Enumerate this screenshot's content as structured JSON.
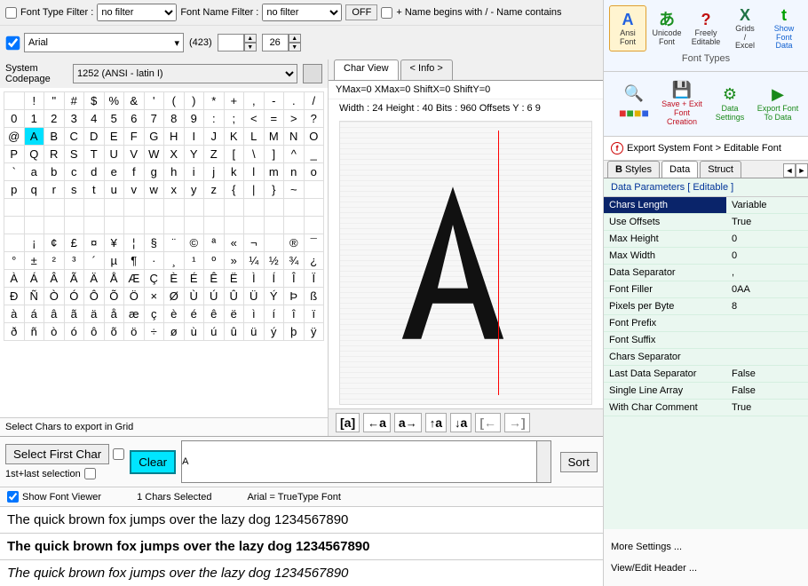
{
  "filters": {
    "fontTypeLabel": "Font Type Filter :",
    "fontTypeValue": "no filter",
    "fontNameLabel": "Font Name Filter :",
    "fontNameValue": "no filter",
    "offLabel": "OFF",
    "nameBeginsLabel": "+ Name begins with / - Name contains"
  },
  "fontRow": {
    "fontName": "Arial",
    "count": "(423)",
    "size": "26"
  },
  "codepage": {
    "label": "System Codepage",
    "value": "1252  (ANSI - latin I)"
  },
  "charGrid": {
    "rows": [
      [
        "",
        "!",
        "\"",
        "#",
        "$",
        "%",
        "&",
        "'",
        "(",
        ")",
        "*",
        "+",
        ",",
        "-",
        ".",
        "/"
      ],
      [
        "0",
        "1",
        "2",
        "3",
        "4",
        "5",
        "6",
        "7",
        "8",
        "9",
        ":",
        ";",
        "<",
        "=",
        ">",
        "?"
      ],
      [
        "@",
        "A",
        "B",
        "C",
        "D",
        "E",
        "F",
        "G",
        "H",
        "I",
        "J",
        "K",
        "L",
        "M",
        "N",
        "O"
      ],
      [
        "P",
        "Q",
        "R",
        "S",
        "T",
        "U",
        "V",
        "W",
        "X",
        "Y",
        "Z",
        "[",
        "\\",
        "]",
        "^",
        "_"
      ],
      [
        "`",
        "a",
        "b",
        "c",
        "d",
        "e",
        "f",
        "g",
        "h",
        "i",
        "j",
        "k",
        "l",
        "m",
        "n",
        "o"
      ],
      [
        "p",
        "q",
        "r",
        "s",
        "t",
        "u",
        "v",
        "w",
        "x",
        "y",
        "z",
        "{",
        "|",
        "}",
        "~",
        ""
      ],
      [
        "",
        "",
        "",
        "",
        "",
        "",
        "",
        "",
        "",
        "",
        "",
        "",
        "",
        "",
        "",
        ""
      ],
      [
        "",
        "",
        "",
        "",
        "",
        "",
        "",
        "",
        "",
        "",
        "",
        "",
        "",
        "",
        "",
        ""
      ],
      [
        "",
        "¡",
        "¢",
        "£",
        "¤",
        "¥",
        "¦",
        "§",
        "¨",
        "©",
        "ª",
        "«",
        "¬",
        "",
        "®",
        "¯"
      ],
      [
        "°",
        "±",
        "²",
        "³",
        "´",
        "µ",
        "¶",
        "·",
        "¸",
        "¹",
        "º",
        "»",
        "¼",
        "½",
        "¾",
        "¿"
      ],
      [
        "À",
        "Á",
        "Â",
        "Ã",
        "Ä",
        "Å",
        "Æ",
        "Ç",
        "È",
        "É",
        "Ê",
        "Ë",
        "Ì",
        "Í",
        "Î",
        "Ï"
      ],
      [
        "Ð",
        "Ñ",
        "Ò",
        "Ó",
        "Ô",
        "Õ",
        "Ö",
        "×",
        "Ø",
        "Ù",
        "Ú",
        "Û",
        "Ü",
        "Ý",
        "Þ",
        "ß"
      ],
      [
        "à",
        "á",
        "â",
        "ã",
        "ä",
        "å",
        "æ",
        "ç",
        "è",
        "é",
        "ê",
        "ë",
        "ì",
        "í",
        "î",
        "ï"
      ],
      [
        "ð",
        "ñ",
        "ò",
        "ó",
        "ô",
        "õ",
        "ö",
        "÷",
        "ø",
        "ù",
        "ú",
        "û",
        "ü",
        "ý",
        "þ",
        "ÿ"
      ]
    ],
    "selected": [
      2,
      1
    ],
    "footer": "Select Chars to export in Grid"
  },
  "charView": {
    "tab1": "Char View",
    "tab2": "< Info >",
    "line1": "YMax=0  XMax=0  ShiftX=0  ShiftY=0",
    "line2": "Width : 24  Height : 40  Bits : 960  Offsets Y : 6 9",
    "toolbar": {
      "bracket": "[a]",
      "leftA": "←a",
      "rightA": "a→",
      "upA": "↑a",
      "downA": "↓a",
      "skipL": "[←",
      "skipR": "→]"
    }
  },
  "bottomLeft": {
    "selectFirstChar": "Select First Char",
    "firstLast": "1st+last selection",
    "clear": "Clear",
    "selectedText": "A",
    "sort": "Sort",
    "showFontViewer": "Show Font Viewer",
    "charsSelected": "1 Chars Selected",
    "fontInfo": "Arial = TrueType Font",
    "preview": "The quick brown fox jumps over the lazy dog 1234567890"
  },
  "rightTop": {
    "buttons": [
      {
        "icon": "A",
        "label": "Ansi Font",
        "color": "#2060e0"
      },
      {
        "icon": "あ",
        "label": "Unicode Font",
        "color": "#1a9020"
      },
      {
        "icon": "?",
        "label": "Freely Editable",
        "color": "#c01010"
      },
      {
        "icon": "X",
        "label": "Grids / Excel",
        "color": "#207245"
      },
      {
        "icon": "t",
        "label": "Show Font Data",
        "color": "#00a000"
      }
    ],
    "caption": "Font Types"
  },
  "rightActions": {
    "buttons": [
      {
        "icon": "🔍",
        "label": ""
      },
      {
        "icon": "💾",
        "label": "Save + Exit Font Creation",
        "color": "#c01020"
      },
      {
        "icon": "⚙",
        "label": "Data Settings",
        "color": "#1a8a1a"
      },
      {
        "icon": "▶",
        "label": "Export Font To Data",
        "color": "#1a8a1a"
      }
    ],
    "colorsIcon": "▦"
  },
  "exportBar": {
    "text": "Export System Font > Editable Font"
  },
  "rightTabs": {
    "t1": "Styles",
    "t2": "Data",
    "t3": "Struct"
  },
  "paramsHeader": "Data Parameters [ Editable ]",
  "params": [
    {
      "k": "Chars Length",
      "v": "Variable",
      "sel": true
    },
    {
      "k": "Use Offsets",
      "v": "True"
    },
    {
      "k": "Max Height",
      "v": "0"
    },
    {
      "k": "Max Width",
      "v": "0"
    },
    {
      "k": "Data Separator",
      "v": ","
    },
    {
      "k": "Font Filler",
      "v": "0AA"
    },
    {
      "k": "Pixels per Byte",
      "v": "8"
    },
    {
      "k": "Font Prefix",
      "v": ""
    },
    {
      "k": "Font Suffix",
      "v": ""
    },
    {
      "k": "Chars Separator",
      "v": ""
    },
    {
      "k": "Last Data Separator",
      "v": "False"
    },
    {
      "k": "Single Line Array",
      "v": "False"
    },
    {
      "k": "With Char Comment",
      "v": "True"
    }
  ],
  "moreLinks": {
    "more": "More Settings ...",
    "header": "View/Edit Header ..."
  }
}
